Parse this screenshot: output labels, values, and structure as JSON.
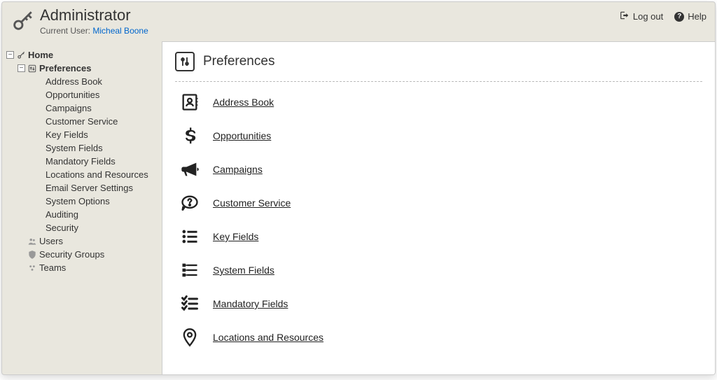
{
  "header": {
    "title": "Administrator",
    "current_user_label": "Current User:",
    "current_user": "Micheal Boone",
    "logout": "Log out",
    "help": "Help"
  },
  "sidebar": {
    "home": {
      "label": "Home"
    },
    "preferences": {
      "label": "Preferences",
      "items": [
        "Address Book",
        "Opportunities",
        "Campaigns",
        "Customer Service",
        "Key Fields",
        "System Fields",
        "Mandatory Fields",
        "Locations and Resources",
        "Email Server Settings",
        "System Options",
        "Auditing",
        "Security"
      ]
    },
    "users": {
      "label": "Users"
    },
    "security_groups": {
      "label": "Security Groups"
    },
    "teams": {
      "label": "Teams"
    }
  },
  "main": {
    "title": "Preferences",
    "items": [
      {
        "label": "Address Book",
        "icon": "address-book-icon"
      },
      {
        "label": "Opportunities",
        "icon": "dollar-icon"
      },
      {
        "label": "Campaigns",
        "icon": "megaphone-icon"
      },
      {
        "label": "Customer Service",
        "icon": "question-bubble-icon"
      },
      {
        "label": "Key Fields",
        "icon": "list-icon"
      },
      {
        "label": "System Fields",
        "icon": "system-fields-icon"
      },
      {
        "label": "Mandatory Fields",
        "icon": "checklist-icon"
      },
      {
        "label": "Locations and Resources",
        "icon": "location-icon"
      }
    ]
  }
}
